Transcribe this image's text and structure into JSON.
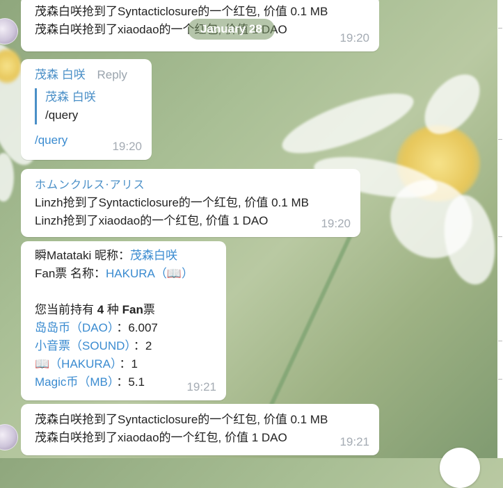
{
  "date_pill": "January 28",
  "messages": {
    "m1": {
      "line1": "茂森白咲抢到了Syntacticlosure的一个红包, 价值 0.1 MB",
      "line2": "茂森白咲抢到了xiaodao的一个红包, 价值 1 DAO",
      "time": "19:20"
    },
    "m2": {
      "sender": "茂森 白咲",
      "reply_label": "Reply",
      "quote_sender": "茂森 白咲",
      "quote_text": "/query",
      "text": "/query",
      "time": "19:20"
    },
    "m3": {
      "sender": "ホムンクルス·アリス",
      "line1": "Linzh抢到了Syntacticlosure的一个红包, 价值 0.1 MB",
      "line2": "Linzh抢到了xiaodao的一个红包, 价值 1 DAO",
      "time": "19:20"
    },
    "m4": {
      "nick_label": "瞬Matataki 昵称：",
      "nick_value": "茂森白咲",
      "fan_label": "Fan票 名称：",
      "fan_value": "HAKURA（📖）",
      "holding_prefix": "您当前持有 ",
      "holding_count": "4",
      "holding_mid": " 种 ",
      "holding_bold": "Fan",
      "holding_suffix": "票",
      "tokens": [
        {
          "name": "岛岛币（DAO）",
          "value": "6.007"
        },
        {
          "name": "小音票（SOUND）",
          "value": "2"
        },
        {
          "name": "📖（HAKURA）",
          "value": "1"
        },
        {
          "name": "Magic币（MB）",
          "value": "5.1"
        }
      ],
      "time": "19:21"
    },
    "m5": {
      "line1": "茂森白咲抢到了Syntacticlosure的一个红包, 价值 0.1 MB",
      "line2": "茂森白咲抢到了xiaodao的一个红包, 价值 1 DAO",
      "time": "19:21"
    }
  }
}
